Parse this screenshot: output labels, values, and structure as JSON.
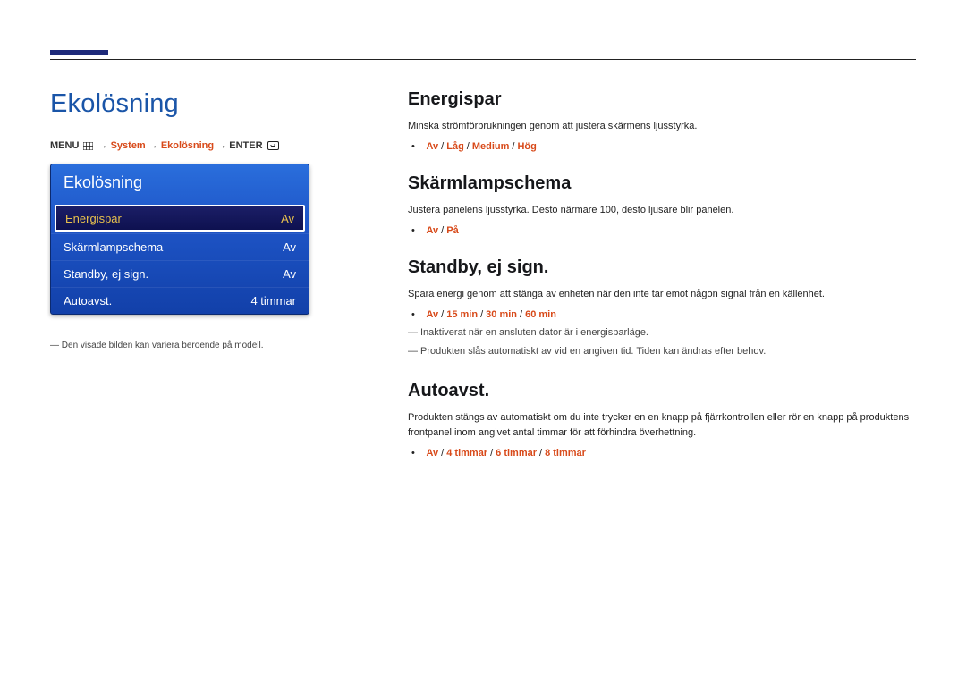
{
  "pageTitle": "Ekolösning",
  "path": {
    "menuLabel": "MENU",
    "seg1": "System",
    "seg2": "Ekolösning",
    "enterLabel": "ENTER"
  },
  "osd": {
    "header": "Ekolösning",
    "rows": [
      {
        "label": "Energispar",
        "value": "Av",
        "selected": true
      },
      {
        "label": "Skärmlampschema",
        "value": "Av",
        "selected": false
      },
      {
        "label": "Standby, ej sign.",
        "value": "Av",
        "selected": false
      },
      {
        "label": "Autoavst.",
        "value": "4 timmar",
        "selected": false
      }
    ]
  },
  "footNote": "Den visade bilden kan variera beroende på modell.",
  "sections": {
    "energispar": {
      "title": "Energispar",
      "desc": "Minska strömförbrukningen genom att justera skärmens ljusstyrka.",
      "options": [
        "Av",
        "Låg",
        "Medium",
        "Hög"
      ]
    },
    "skarm": {
      "title": "Skärmlampschema",
      "desc": "Justera panelens ljusstyrka. Desto närmare 100, desto ljusare blir panelen.",
      "options": [
        "Av",
        "På"
      ]
    },
    "standby": {
      "title": "Standby, ej sign.",
      "desc": "Spara energi genom att stänga av enheten när den inte tar emot någon signal från en källenhet.",
      "options": [
        "Av",
        "15 min",
        "30 min",
        "60 min"
      ],
      "note1": "Inaktiverat när en ansluten dator är i energisparläge.",
      "note2": "Produkten slås automatiskt av vid en angiven tid. Tiden kan ändras efter behov."
    },
    "autoavst": {
      "title": "Autoavst.",
      "desc": "Produkten stängs av automatiskt om du inte trycker en en knapp på fjärrkontrollen eller rör en knapp på produktens frontpanel inom angivet antal timmar för att förhindra överhettning.",
      "options": [
        "Av",
        "4 timmar",
        "6 timmar",
        "8 timmar"
      ]
    }
  }
}
